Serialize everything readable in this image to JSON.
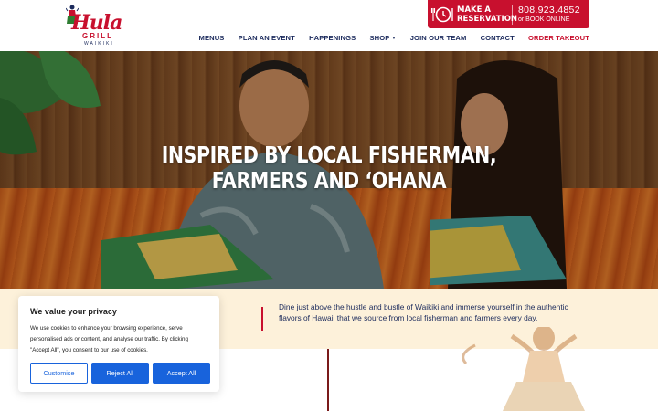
{
  "brand": {
    "logo_word": "Hula",
    "logo_sub": "GRILL",
    "logo_location": "WAIKIKI",
    "primary_color": "#c8102e",
    "navy_color": "#1b2a5c"
  },
  "reservation": {
    "icon": "plate-clock-icon",
    "label_line1": "MAKE A",
    "label_line2": "RESERVATION",
    "phone": "808.923.4852",
    "book_online": "or BOOK ONLINE"
  },
  "nav": {
    "items": [
      {
        "label": "MENUS"
      },
      {
        "label": "PLAN AN EVENT"
      },
      {
        "label": "HAPPENINGS"
      },
      {
        "label": "SHOP"
      },
      {
        "label": "JOIN OUR TEAM"
      },
      {
        "label": "CONTACT"
      },
      {
        "label": "ORDER TAKEOUT"
      }
    ],
    "shop_caret": "▼"
  },
  "hero": {
    "title_line1": "INSPIRED BY LOCAL FISHERMAN,",
    "title_line2": "FARMERS AND ‘OHANA"
  },
  "intro": {
    "text": "Dine just above the hustle and bustle of Waikiki and immerse yourself in the authentic flavors of Hawaii that we source from local fisherman and farmers every day."
  },
  "cookie": {
    "title": "We value your privacy",
    "text": "We use cookies to enhance your browsing experience, serve personalised ads or content, and analyse our traffic. By clicking \"Accept All\", you consent to our use of cookies.",
    "customise": "Customise",
    "reject": "Reject All",
    "accept": "Accept All",
    "button_color": "#1863dc"
  }
}
